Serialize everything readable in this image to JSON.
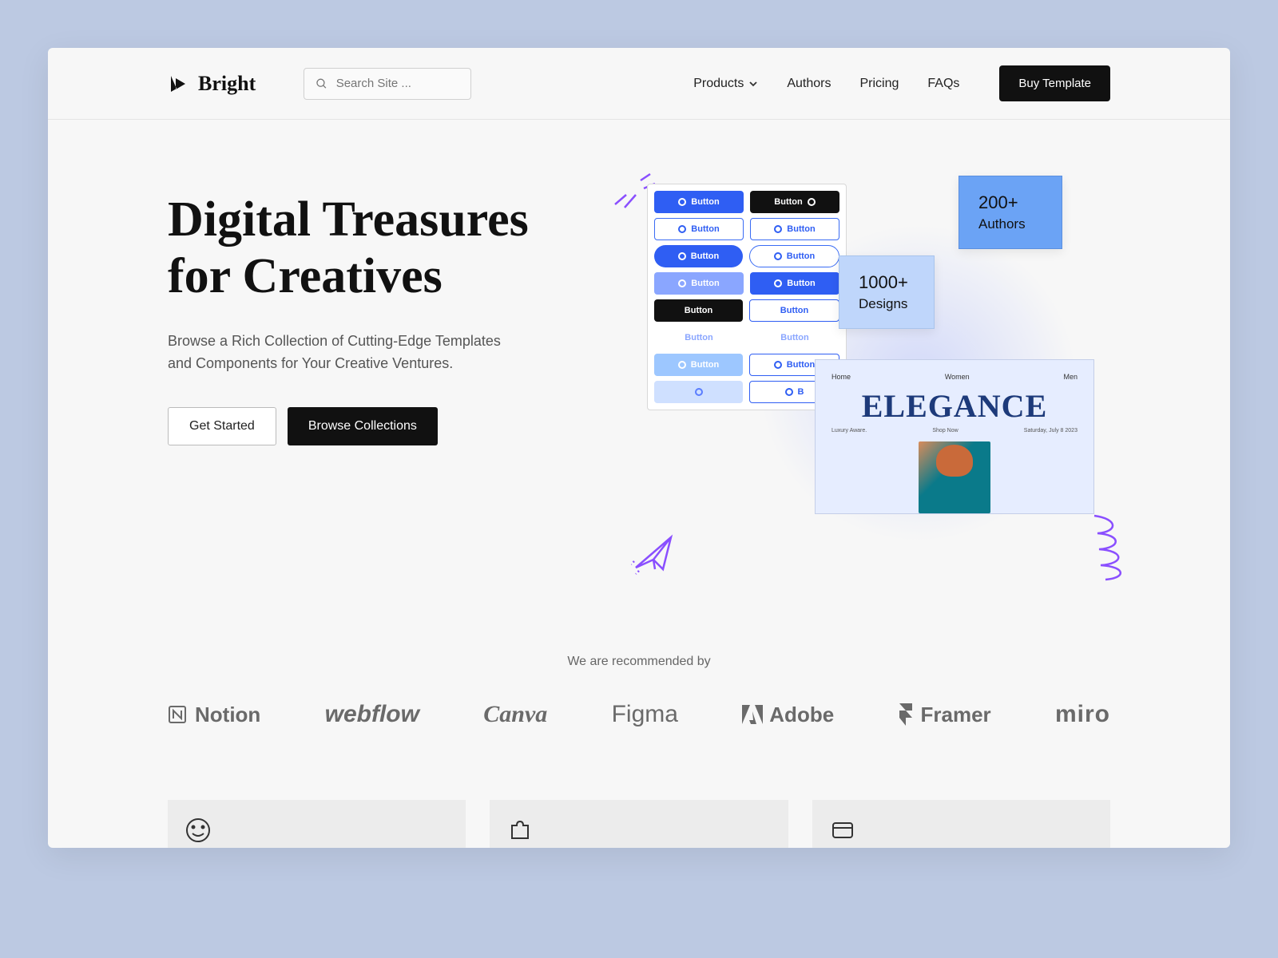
{
  "brand": "Bright",
  "search": {
    "placeholder": "Search Site ..."
  },
  "nav": {
    "products": "Products",
    "authors": "Authors",
    "pricing": "Pricing",
    "faqs": "FAQs"
  },
  "cta_header": "Buy Template",
  "hero": {
    "title": "Digital Treasures for Creatives",
    "subtitle": "Browse a Rich Collection of Cutting-Edge Templates and Components for Your Creative Ventures.",
    "primary": "Get Started",
    "secondary": "Browse Collections"
  },
  "illus": {
    "button_label": "Button",
    "stat1_num": "200+",
    "stat1_label": "Authors",
    "stat2_num": "1000+",
    "stat2_label": "Designs",
    "elegance_title": "ELEGANCE",
    "elegance_nav": {
      "a": "Home",
      "b": "Women",
      "c": "Men"
    },
    "elegance_sub": {
      "a": "Luxury Aware.",
      "b": "Shop Now",
      "c": "Saturday, July 8 2023"
    }
  },
  "recommended_label": "We are recommended by",
  "brands": {
    "notion": "Notion",
    "webflow": "webflow",
    "canva": "Canva",
    "figma": "Figma",
    "adobe": "Adobe",
    "framer": "Framer",
    "miro": "miro"
  }
}
